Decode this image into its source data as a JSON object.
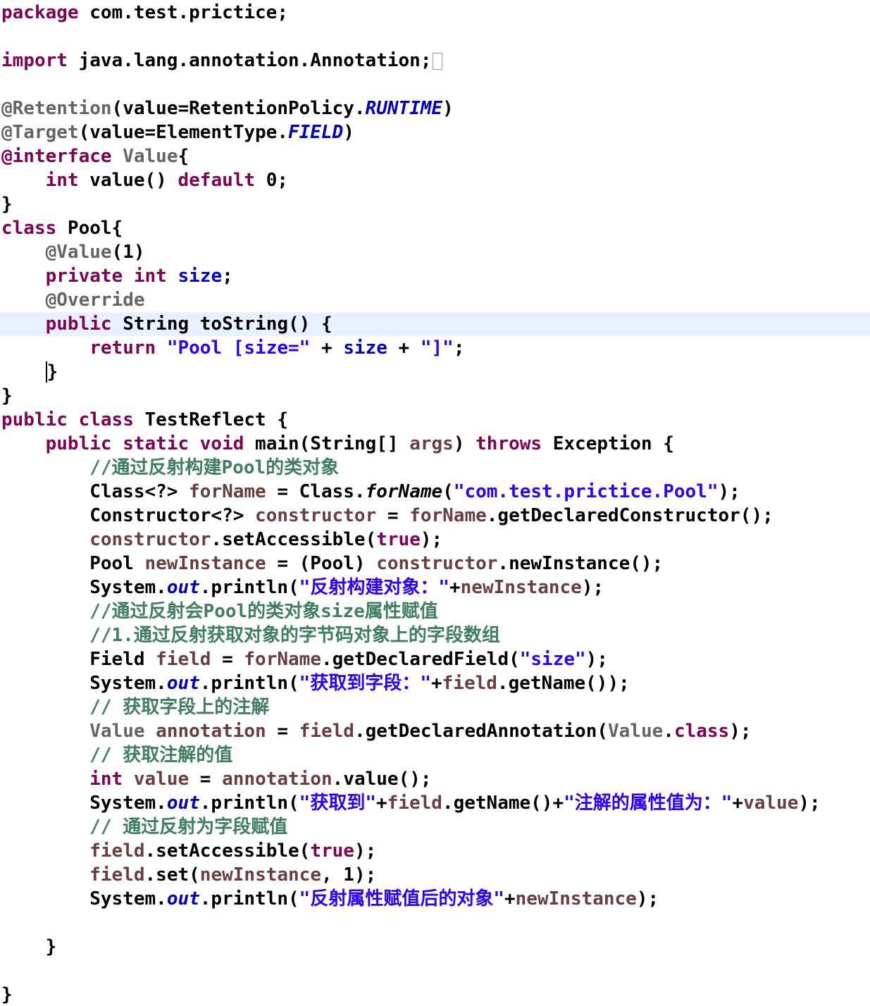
{
  "editor": {
    "language": "Java",
    "highlighted_line_index": 13,
    "colors": {
      "keyword": "#7f0055",
      "annotation": "#646464",
      "string": "#2a00ff",
      "field": "#0000c0",
      "local_variable": "#6a3e3e",
      "comment": "#3f7f5f",
      "current_line_highlight": "#e8f2fe"
    },
    "lines": [
      [
        [
          "kw",
          "package"
        ],
        [
          "plain",
          " com.test.prictice;"
        ]
      ],
      [],
      [
        [
          "kw",
          "import"
        ],
        [
          "plain",
          " java.lang.annotation.Annotation;"
        ],
        [
          "box",
          ""
        ]
      ],
      [],
      [
        [
          "ann",
          "@Retention"
        ],
        [
          "plain",
          "(value=RetentionPolicy."
        ],
        [
          "sfi",
          "RUNTIME"
        ],
        [
          "plain",
          ")"
        ]
      ],
      [
        [
          "ann",
          "@Target"
        ],
        [
          "plain",
          "(value=ElementType."
        ],
        [
          "sfi",
          "FIELD"
        ],
        [
          "plain",
          ")"
        ]
      ],
      [
        [
          "kw",
          "@interface"
        ],
        [
          "plain",
          " "
        ],
        [
          "ann",
          "Value"
        ],
        [
          "plain",
          "{"
        ]
      ],
      [
        [
          "plain",
          "    "
        ],
        [
          "kw",
          "int"
        ],
        [
          "plain",
          " value() "
        ],
        [
          "kw",
          "default"
        ],
        [
          "plain",
          " 0;"
        ]
      ],
      [
        [
          "plain",
          "}"
        ]
      ],
      [
        [
          "kw",
          "class"
        ],
        [
          "plain",
          " Pool{"
        ]
      ],
      [
        [
          "plain",
          "    "
        ],
        [
          "ann",
          "@Value"
        ],
        [
          "plain",
          "(1)"
        ]
      ],
      [
        [
          "plain",
          "    "
        ],
        [
          "kw",
          "private"
        ],
        [
          "plain",
          " "
        ],
        [
          "kw",
          "int"
        ],
        [
          "plain",
          " "
        ],
        [
          "fld",
          "size"
        ],
        [
          "plain",
          ";"
        ]
      ],
      [
        [
          "plain",
          "    "
        ],
        [
          "ann",
          "@Override"
        ]
      ],
      [
        [
          "plain",
          "    "
        ],
        [
          "kw",
          "public"
        ],
        [
          "plain",
          " String toString() {"
        ]
      ],
      [
        [
          "plain",
          "        "
        ],
        [
          "kw",
          "return"
        ],
        [
          "plain",
          " "
        ],
        [
          "str",
          "\"Pool [size=\""
        ],
        [
          "plain",
          " + "
        ],
        [
          "fld",
          "size"
        ],
        [
          "plain",
          " + "
        ],
        [
          "str",
          "\"]\""
        ],
        [
          "plain",
          ";"
        ]
      ],
      [
        [
          "plain",
          "    "
        ],
        [
          "caret",
          "}"
        ]
      ],
      [
        [
          "plain",
          "}"
        ]
      ],
      [
        [
          "kw",
          "public"
        ],
        [
          "plain",
          " "
        ],
        [
          "kw",
          "class"
        ],
        [
          "plain",
          " TestReflect {"
        ]
      ],
      [
        [
          "plain",
          "    "
        ],
        [
          "kw",
          "public"
        ],
        [
          "plain",
          " "
        ],
        [
          "kw",
          "static"
        ],
        [
          "plain",
          " "
        ],
        [
          "kw",
          "void"
        ],
        [
          "plain",
          " main(String[] "
        ],
        [
          "var",
          "args"
        ],
        [
          "plain",
          ") "
        ],
        [
          "kw",
          "throws"
        ],
        [
          "plain",
          " Exception {"
        ]
      ],
      [
        [
          "plain",
          "        "
        ],
        [
          "cmt",
          "//通过反射构建Pool的类对象"
        ]
      ],
      [
        [
          "plain",
          "        Class<?> "
        ],
        [
          "var",
          "forName"
        ],
        [
          "plain",
          " = Class."
        ],
        [
          "ital",
          "forName"
        ],
        [
          "plain",
          "("
        ],
        [
          "str",
          "\"com.test.prictice.Pool\""
        ],
        [
          "plain",
          ");"
        ]
      ],
      [
        [
          "plain",
          "        Constructor<?> "
        ],
        [
          "var",
          "constructor"
        ],
        [
          "plain",
          " = "
        ],
        [
          "var",
          "forName"
        ],
        [
          "plain",
          ".getDeclaredConstructor();"
        ]
      ],
      [
        [
          "plain",
          "        "
        ],
        [
          "var",
          "constructor"
        ],
        [
          "plain",
          ".setAccessible("
        ],
        [
          "kw",
          "true"
        ],
        [
          "plain",
          ");"
        ]
      ],
      [
        [
          "plain",
          "        Pool "
        ],
        [
          "var",
          "newInstance"
        ],
        [
          "plain",
          " = (Pool) "
        ],
        [
          "var",
          "constructor"
        ],
        [
          "plain",
          ".newInstance();"
        ]
      ],
      [
        [
          "plain",
          "        System."
        ],
        [
          "sfi",
          "out"
        ],
        [
          "plain",
          ".println("
        ],
        [
          "str",
          "\"反射构建对象：\""
        ],
        [
          "plain",
          "+"
        ],
        [
          "var",
          "newInstance"
        ],
        [
          "plain",
          ");"
        ]
      ],
      [
        [
          "plain",
          "        "
        ],
        [
          "cmt",
          "//通过反射会Pool的类对象size属性赋值"
        ]
      ],
      [
        [
          "plain",
          "        "
        ],
        [
          "cmt",
          "//1.通过反射获取对象的字节码对象上的字段数组"
        ]
      ],
      [
        [
          "plain",
          "        Field "
        ],
        [
          "var",
          "field"
        ],
        [
          "plain",
          " = "
        ],
        [
          "var",
          "forName"
        ],
        [
          "plain",
          ".getDeclaredField("
        ],
        [
          "str",
          "\"size\""
        ],
        [
          "plain",
          ");"
        ]
      ],
      [
        [
          "plain",
          "        System."
        ],
        [
          "sfi",
          "out"
        ],
        [
          "plain",
          ".println("
        ],
        [
          "str",
          "\"获取到字段：\""
        ],
        [
          "plain",
          "+"
        ],
        [
          "var",
          "field"
        ],
        [
          "plain",
          ".getName());"
        ]
      ],
      [
        [
          "plain",
          "        "
        ],
        [
          "cmt",
          "// 获取字段上的注解"
        ]
      ],
      [
        [
          "plain",
          "        "
        ],
        [
          "ann",
          "Value"
        ],
        [
          "plain",
          " "
        ],
        [
          "var",
          "annotation"
        ],
        [
          "plain",
          " = "
        ],
        [
          "var",
          "field"
        ],
        [
          "plain",
          ".getDeclaredAnnotation("
        ],
        [
          "ann",
          "Value"
        ],
        [
          "plain",
          "."
        ],
        [
          "kw",
          "class"
        ],
        [
          "plain",
          ");"
        ]
      ],
      [
        [
          "plain",
          "        "
        ],
        [
          "cmt",
          "// 获取注解的值"
        ]
      ],
      [
        [
          "plain",
          "        "
        ],
        [
          "kw",
          "int"
        ],
        [
          "plain",
          " "
        ],
        [
          "var",
          "value"
        ],
        [
          "plain",
          " = "
        ],
        [
          "var",
          "annotation"
        ],
        [
          "plain",
          ".value();"
        ]
      ],
      [
        [
          "plain",
          "        System."
        ],
        [
          "sfi",
          "out"
        ],
        [
          "plain",
          ".println("
        ],
        [
          "str",
          "\"获取到\""
        ],
        [
          "plain",
          "+"
        ],
        [
          "var",
          "field"
        ],
        [
          "plain",
          ".getName()+"
        ],
        [
          "str",
          "\"注解的属性值为：\""
        ],
        [
          "plain",
          "+"
        ],
        [
          "var",
          "value"
        ],
        [
          "plain",
          ");"
        ]
      ],
      [
        [
          "plain",
          "        "
        ],
        [
          "cmt",
          "// 通过反射为字段赋值"
        ]
      ],
      [
        [
          "plain",
          "        "
        ],
        [
          "var",
          "field"
        ],
        [
          "plain",
          ".setAccessible("
        ],
        [
          "kw",
          "true"
        ],
        [
          "plain",
          ");"
        ]
      ],
      [
        [
          "plain",
          "        "
        ],
        [
          "var",
          "field"
        ],
        [
          "plain",
          ".set("
        ],
        [
          "var",
          "newInstance"
        ],
        [
          "plain",
          ", 1);"
        ]
      ],
      [
        [
          "plain",
          "        System."
        ],
        [
          "sfi",
          "out"
        ],
        [
          "plain",
          ".println("
        ],
        [
          "str",
          "\"反射属性赋值后的对象\""
        ],
        [
          "plain",
          "+"
        ],
        [
          "var",
          "newInstance"
        ],
        [
          "plain",
          ");"
        ]
      ],
      [],
      [
        [
          "plain",
          "    }"
        ]
      ],
      [],
      [
        [
          "plain",
          "}"
        ]
      ]
    ]
  }
}
